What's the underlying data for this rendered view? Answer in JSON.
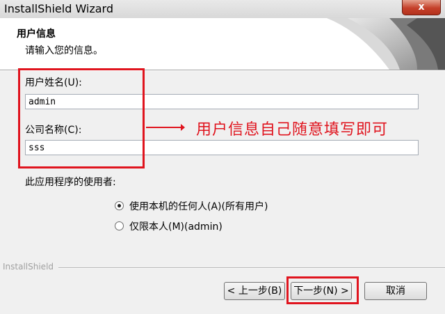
{
  "window": {
    "title": "InstallShield Wizard",
    "close_glyph": "x"
  },
  "header": {
    "title": "用户信息",
    "subtitle": "请输入您的信息。"
  },
  "form": {
    "username_label": "用户姓名(U):",
    "username_value": "admin",
    "company_label": "公司名称(C):",
    "company_value": "sss",
    "users_label": "此应用程序的使用者:",
    "options": [
      {
        "label": "使用本机的任何人(A)(所有用户)",
        "selected": true
      },
      {
        "label": "仅限本人(M)(admin)",
        "selected": false
      }
    ]
  },
  "annotation": {
    "text": "用户信息自己随意填写即可",
    "color": "#e0141e"
  },
  "footer": {
    "brand": "InstallShield",
    "back_label": "< 上一步(B)",
    "next_label": "下一步(N) >",
    "cancel_label": "取消"
  }
}
